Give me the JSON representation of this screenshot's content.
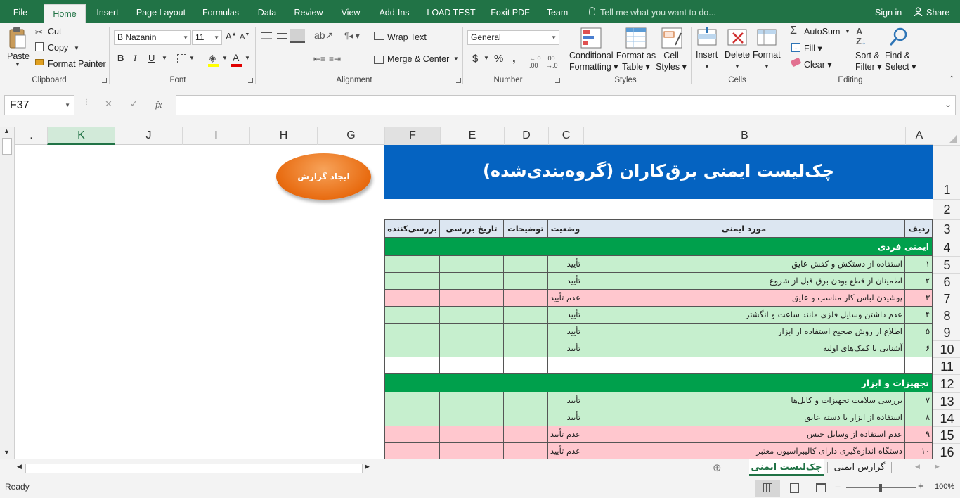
{
  "tabs": [
    "File",
    "Home",
    "Insert",
    "Page Layout",
    "Formulas",
    "Data",
    "Review",
    "View",
    "Add-Ins",
    "LOAD TEST",
    "Foxit PDF",
    "Team"
  ],
  "tell_me": "Tell me what you want to do...",
  "signin": "Sign in",
  "share": "Share",
  "clipboard": {
    "paste": "Paste",
    "cut": "Cut",
    "copy": "Copy",
    "format_painter": "Format Painter",
    "label": "Clipboard"
  },
  "font": {
    "name": "B Nazanin",
    "size": "11",
    "label": "Font",
    "bold": "B",
    "italic": "I",
    "underline": "U"
  },
  "alignment": {
    "wrap_text": "Wrap Text",
    "merge_center": "Merge & Center",
    "label": "Alignment"
  },
  "number": {
    "format": "General",
    "label": "Number",
    "currency": "$",
    "percent": "%",
    "comma": ","
  },
  "styles": {
    "conditional": "Conditional",
    "conditional2": "Formatting",
    "format_as": "Format as",
    "format_as2": "Table",
    "cell": "Cell",
    "cell2": "Styles",
    "label": "Styles"
  },
  "cells": {
    "insert": "Insert",
    "delete": "Delete",
    "format": "Format",
    "label": "Cells"
  },
  "editing": {
    "autosum": "AutoSum",
    "fill": "Fill",
    "clear": "Clear",
    "sort": "Sort &",
    "sort2": "Filter",
    "find": "Find &",
    "find2": "Select",
    "label": "Editing"
  },
  "namebox": "F37",
  "fx": "fx",
  "columns": [
    "K",
    "J",
    "I",
    "H",
    "G",
    "F",
    "E",
    "D",
    "C",
    "B",
    "A"
  ],
  "rows": [
    "1",
    "2",
    "3",
    "4",
    "5",
    "6",
    "7",
    "8",
    "9",
    "10",
    "11",
    "12",
    "13",
    "14",
    "15",
    "16"
  ],
  "sheet": {
    "title": "چک‌لیست ایمنی برق‌کاران (گروه‌بندی‌شده)",
    "button": "ایجاد گزارش",
    "headers": {
      "row": "ردیف",
      "item": "مورد ایمنی",
      "status": "وضعیت",
      "notes": "توضیحات",
      "date": "تاریخ بررسی",
      "reviewer": "بررسی‌کننده"
    },
    "group1": "ایمنی فردی",
    "group2": "تجهیزات و ابزار",
    "items": [
      {
        "n": "۱",
        "text": "استفاده از دستکش و کفش عایق",
        "status": "تأیید",
        "ok": true
      },
      {
        "n": "۲",
        "text": "اطمینان از قطع بودن برق قبل از شروع",
        "status": "تأیید",
        "ok": true
      },
      {
        "n": "۳",
        "text": "پوشیدن لباس کار مناسب و عایق",
        "status": "عدم تأیید",
        "ok": false
      },
      {
        "n": "۴",
        "text": "عدم داشتن وسایل فلزی مانند ساعت و انگشتر",
        "status": "تأیید",
        "ok": true
      },
      {
        "n": "۵",
        "text": "اطلاع از روش صحیح استفاده از ابزار",
        "status": "تأیید",
        "ok": true
      },
      {
        "n": "۶",
        "text": "آشنایی با کمک‌های اولیه",
        "status": "تأیید",
        "ok": true
      }
    ],
    "items2": [
      {
        "n": "۷",
        "text": "بررسی سلامت تجهیزات و کابل‌ها",
        "status": "تأیید",
        "ok": true
      },
      {
        "n": "۸",
        "text": "استفاده از ابزار با دسته عایق",
        "status": "تأیید",
        "ok": true
      },
      {
        "n": "۹",
        "text": "عدم استفاده از وسایل خیس",
        "status": "عدم تأیید",
        "ok": false
      },
      {
        "n": "۱۰",
        "text": "دستگاه اندازه‌گیری دارای کالیبراسیون معتبر",
        "status": "عدم تأیید",
        "ok": false
      }
    ]
  },
  "sheet_tabs": [
    "چک‌لیست ایمنی",
    "گزارش ایمنی"
  ],
  "status": "Ready",
  "zoom": "100%",
  "colors": {
    "green": "#217346",
    "title_blue": "#0563c1",
    "group_green": "#00a04c",
    "ok_fill": "#c6efce",
    "bad_fill": "#ffc7ce",
    "header_fill": "#dce6f1"
  }
}
